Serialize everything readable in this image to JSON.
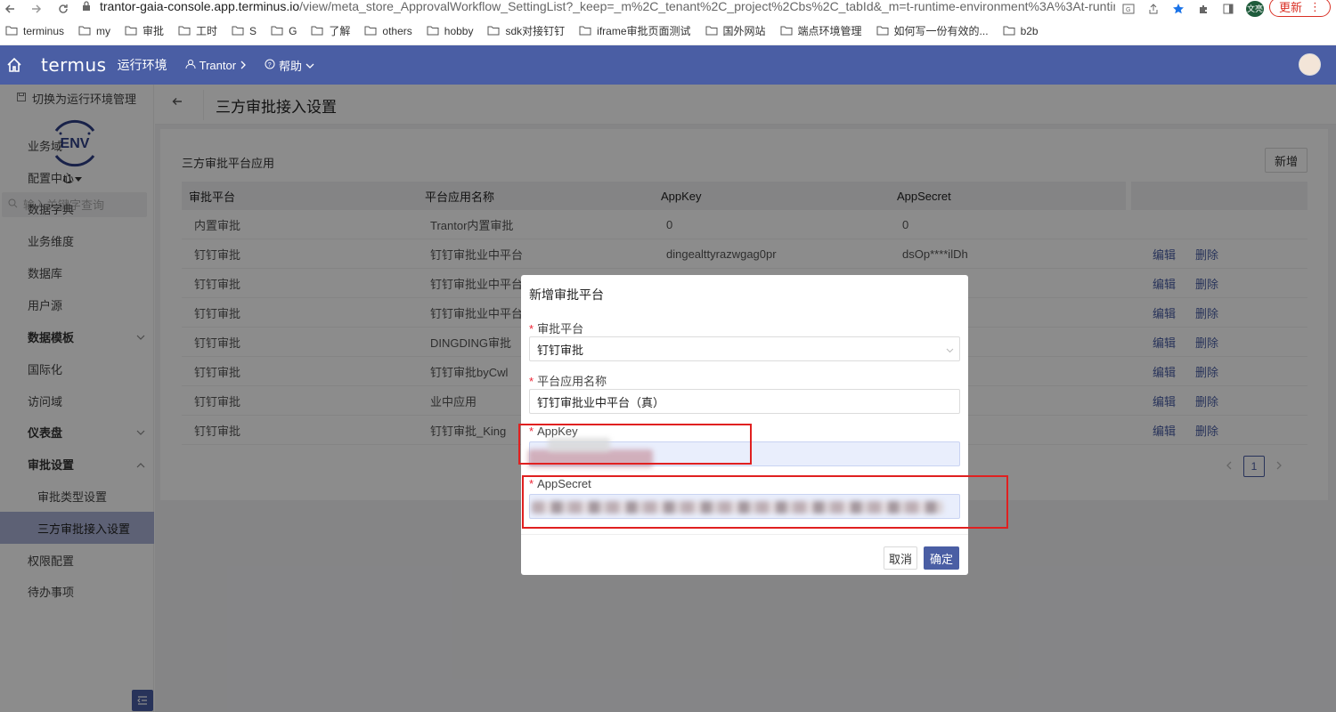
{
  "browser": {
    "url_host": "trantor-gaia-console.app.terminus.io",
    "url_path": "/view/meta_store_ApprovalWorkflow_SettingList?_keep=_m%2C_tenant%2C_project%2Cbs%2C_tabId&_m=t-runtime-environment%3A%3At-runtime...",
    "profile_initials": "文亮",
    "update_label": "更新",
    "bookmarks": [
      "terminus",
      "my",
      "审批",
      "工时",
      "S",
      "G",
      "了解",
      "others",
      "hobby",
      "sdk对接钉钉",
      "iframe审批页面测试",
      "国外网站",
      "端点环境管理",
      "如何写一份有效的...",
      "b2b"
    ]
  },
  "header": {
    "logo": "termus",
    "env_title": "运行环境",
    "nav_trantor": "Trantor",
    "nav_help": "帮助"
  },
  "sidebar": {
    "switch_env": "切换为运行环境管理",
    "env_logo_text": "ENV",
    "env_name": "t1",
    "search_placeholder": "输入关键字查询",
    "items": [
      {
        "label": "业务域"
      },
      {
        "label": "配置中心"
      },
      {
        "label": "数据字典"
      },
      {
        "label": "业务维度"
      },
      {
        "label": "数据库"
      },
      {
        "label": "用户源"
      },
      {
        "label": "数据模板"
      },
      {
        "label": "国际化"
      },
      {
        "label": "访问域"
      },
      {
        "label": "仪表盘"
      },
      {
        "label": "审批设置"
      },
      {
        "label": "审批类型设置"
      },
      {
        "label": "三方审批接入设置"
      },
      {
        "label": "权限配置"
      },
      {
        "label": "待办事项"
      }
    ]
  },
  "page": {
    "title": "三方审批接入设置",
    "section_title": "三方审批平台应用",
    "add_label": "新增",
    "columns": [
      "审批平台",
      "平台应用名称",
      "AppKey",
      "AppSecret"
    ],
    "edit_label": "编辑",
    "delete_label": "删除",
    "rows": [
      {
        "platform": "内置审批",
        "app": "Trantor内置审批",
        "key": "0",
        "secret": "0"
      },
      {
        "platform": "钉钉审批",
        "app": "钉钉审批业中平台",
        "key": "dingealttyrazwgag0pr",
        "secret": "dsOp****ilDh"
      },
      {
        "platform": "钉钉审批",
        "app": "钉钉审批业中平台",
        "key": "",
        "secret": ""
      },
      {
        "platform": "钉钉审批",
        "app": "钉钉审批业中平台",
        "key": "",
        "secret": ""
      },
      {
        "platform": "钉钉审批",
        "app": "DINGDING审批",
        "key": "",
        "secret": ""
      },
      {
        "platform": "钉钉审批",
        "app": "钉钉审批byCwl",
        "key": "",
        "secret": ""
      },
      {
        "platform": "钉钉审批",
        "app": "业中应用",
        "key": "",
        "secret": ""
      },
      {
        "platform": "钉钉审批",
        "app": "钉钉审批_King",
        "key": "",
        "secret": ""
      }
    ],
    "page_num": "1"
  },
  "modal": {
    "title": "新增审批平台",
    "platform_label": "审批平台",
    "platform_value": "钉钉审批",
    "appname_label": "平台应用名称",
    "appname_value": "钉钉审批业中平台（真）",
    "appkey_label": "AppKey",
    "appsecret_label": "AppSecret",
    "cancel_label": "取消",
    "ok_label": "确定"
  },
  "colors": {
    "brand": "#4a5ea4",
    "highlight_box": "#e02020",
    "sidebar_active": "#aab1d6"
  }
}
